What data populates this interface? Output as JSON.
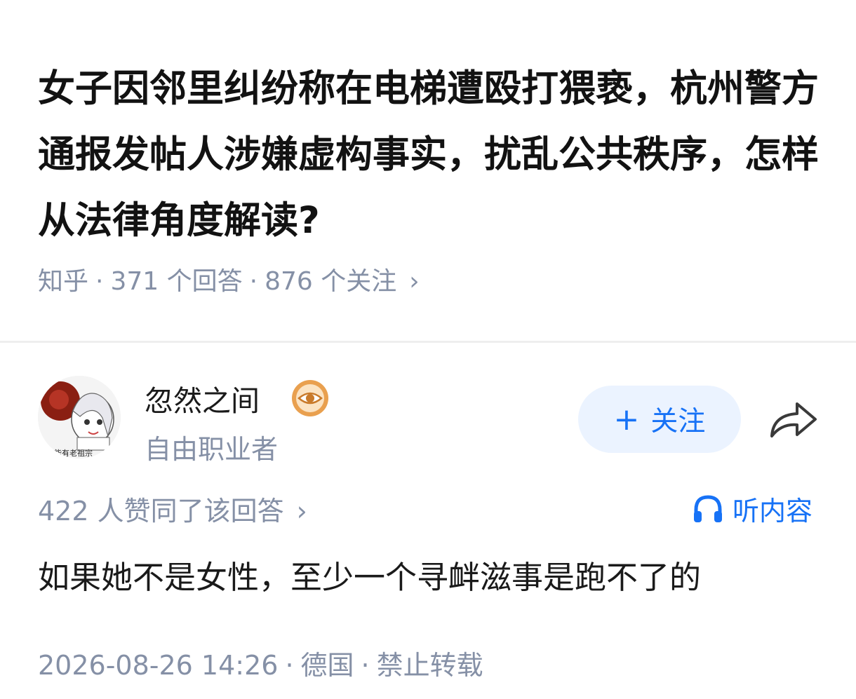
{
  "question": {
    "title": "女子因邻里纠纷称在电梯遭殴打猥亵，杭州警方通报发帖人涉嫌虚构事实，扰乱公共秩序，怎样从法律角度解读?",
    "source": "知乎",
    "answers": "371 个回答",
    "followers": "876 个关注",
    "chevron": "›"
  },
  "author": {
    "name": "忽然之间",
    "title": "自由职业者",
    "avatar_caption": "不能有老祖宗",
    "badge_icon": "eye-badge-icon"
  },
  "actions": {
    "follow_label": "关注",
    "follow_plus": "+",
    "share_icon": "share-arrow-icon"
  },
  "answer": {
    "upvotes": "422 人赞同了该回答",
    "chevron": "›",
    "listen_label": "听内容",
    "content": "如果她不是女性，至少一个寻衅滋事是跑不了的",
    "date": "2026-08-26 14:26",
    "location": "德国",
    "copyright": "禁止转载",
    "dot": "·"
  },
  "colors": {
    "accent": "#1772f6",
    "muted": "#8590a6",
    "follow_bg": "#ebf3ff",
    "badge": "#e9a04f"
  }
}
